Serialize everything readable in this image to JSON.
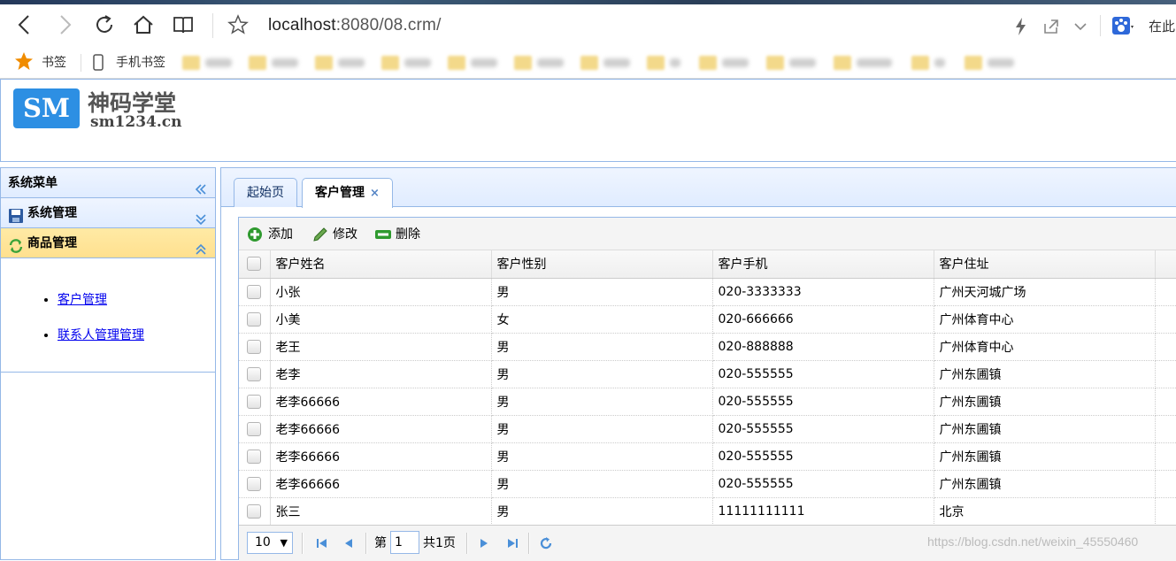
{
  "browser": {
    "url_host": "localhost",
    "url_rest": ":8080/08.crm/",
    "search_text": "在此"
  },
  "bookmarks": {
    "bookmarks_label": "书签",
    "mobile_label": "手机书签"
  },
  "header": {
    "logo_abbr": "SM",
    "logo_name": "神码学堂",
    "logo_url": "sm1234.cn"
  },
  "west": {
    "title": "系统菜单",
    "sections": [
      {
        "label": "系统管理"
      },
      {
        "label": "商品管理"
      }
    ],
    "links": [
      {
        "label": "客户管理"
      },
      {
        "label": "联系人管理管理"
      }
    ]
  },
  "tabs": [
    {
      "label": "起始页"
    },
    {
      "label": "客户管理",
      "close": "×"
    }
  ],
  "toolbar": {
    "add": "添加",
    "edit": "修改",
    "delete": "删除"
  },
  "table": {
    "columns": [
      "客户姓名",
      "客户性别",
      "客户手机",
      "客户住址"
    ],
    "rows": [
      [
        "小张",
        "男",
        "020-3333333",
        "广州天河城广场"
      ],
      [
        "小美",
        "女",
        "020-666666",
        "广州体育中心"
      ],
      [
        "老王",
        "男",
        "020-888888",
        "广州体育中心"
      ],
      [
        "老李",
        "男",
        "020-555555",
        "广州东圃镇"
      ],
      [
        "老李66666",
        "男",
        "020-555555",
        "广州东圃镇"
      ],
      [
        "老李66666",
        "男",
        "020-555555",
        "广州东圃镇"
      ],
      [
        "老李66666",
        "男",
        "020-555555",
        "广州东圃镇"
      ],
      [
        "老李66666",
        "男",
        "020-555555",
        "广州东圃镇"
      ],
      [
        "张三",
        "男",
        "11111111111",
        "北京"
      ]
    ]
  },
  "pager": {
    "page_size": "10",
    "page_prefix": "第",
    "page_value": "1",
    "page_total": "共1页"
  },
  "watermark": "https://blog.csdn.net/weixin_45550460",
  "colors": {
    "panel_border": "#95b8e7",
    "accent_blue": "#2d8fe3",
    "selected_header": "#ffe08f"
  }
}
